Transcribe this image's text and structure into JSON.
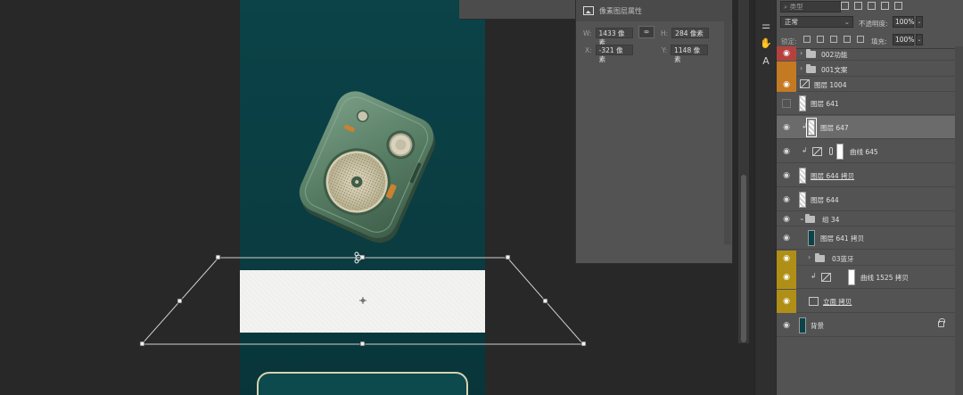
{
  "properties_panel": {
    "title": "像素图层属性",
    "w_label": "W:",
    "w_value": "1433 像素",
    "h_label": "H:",
    "h_value": "284 像素",
    "x_label": "X:",
    "x_value": "-321 像素",
    "y_label": "Y:",
    "y_value": "1148 像素",
    "link_icon": "link-icon"
  },
  "layers_panel": {
    "search_placeholder": "类型",
    "blend_mode": "正常",
    "opacity_label": "不透明度:",
    "opacity_value": "100%",
    "lock_label": "锁定:",
    "fill_label": "填充:",
    "fill_value": "100%",
    "layers": [
      {
        "name": "002功能",
        "kind": "group",
        "eye": "red"
      },
      {
        "name": "001文案",
        "kind": "group",
        "eye": "orange"
      },
      {
        "name": "图层 1004",
        "kind": "smart",
        "eye": "orange"
      },
      {
        "name": "图层 641",
        "kind": "pixel",
        "eye": "hidden"
      },
      {
        "name": "图层 647",
        "kind": "pixel",
        "eye": "visible",
        "selected": true
      },
      {
        "name": "曲线 645",
        "kind": "adjustment",
        "eye": "visible"
      },
      {
        "name": "图层 644 拷贝",
        "kind": "pixel",
        "eye": "visible"
      },
      {
        "name": "图层 644",
        "kind": "pixel",
        "eye": "visible"
      },
      {
        "name": "组 34",
        "kind": "group-open",
        "eye": "visible"
      },
      {
        "name": "图层 641 拷贝",
        "kind": "pixel-dark",
        "eye": "visible"
      },
      {
        "name": "03蓝牙",
        "kind": "group",
        "eye": "yellow"
      },
      {
        "name": "曲线 1525 拷贝",
        "kind": "adjustment",
        "eye": "yellow"
      },
      {
        "name": "立面 拷贝",
        "kind": "frame",
        "eye": "yellow"
      },
      {
        "name": "背景",
        "kind": "background",
        "eye": "visible"
      }
    ]
  },
  "colors": {
    "document_bg": "#0b4348",
    "paper": "#f3f3f1",
    "radio_body": "#5b8067",
    "label_red": "#b3423f",
    "label_orange": "#c47a22",
    "label_yellow": "#b08f17"
  }
}
